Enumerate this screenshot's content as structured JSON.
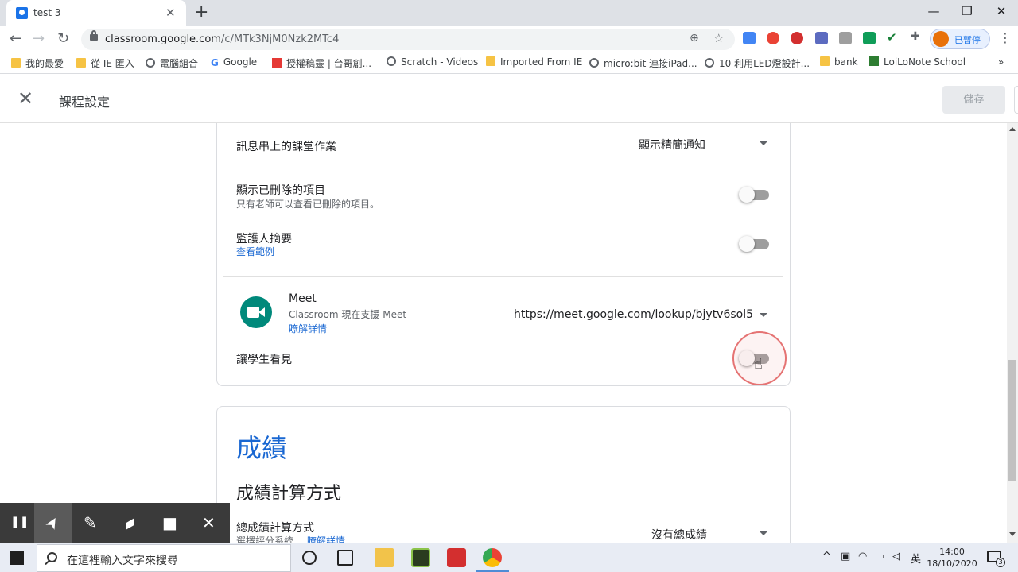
{
  "browser": {
    "tab_title": "test 3",
    "tab_close": "✕",
    "new_tab": "+",
    "minimize": "—",
    "maximize": "❐",
    "close_window": "✕",
    "url_host": "classroom.google.com",
    "url_path": "/c/MTk3NjM0Nzk2MTc4",
    "profile_label": "已暫停",
    "bookmarks": [
      "我的最愛",
      "從 IE 匯入",
      "電腦組合",
      "Google",
      "授權稿靈 | 台哥創...",
      "Scratch - Videos",
      "Imported From IE",
      "micro:bit 連接iPad...",
      "10 利用LED燈設計...",
      "bank",
      "LoiLoNote School"
    ],
    "bookmarks_more": "»"
  },
  "header": {
    "close": "✕",
    "title": "課程設定",
    "save": "儲存"
  },
  "general": {
    "stream_classwork_label": "訊息串上的課堂作業",
    "stream_classwork_value": "顯示精簡通知",
    "show_deleted_label": "顯示已刪除的項目",
    "show_deleted_desc": "只有老師可以查看已刪除的項目。",
    "guardian_label": "監護人摘要",
    "guardian_link": "查看範例"
  },
  "meet": {
    "title": "Meet",
    "desc": "Classroom 現在支援 Meet",
    "learn_more": "瞭解詳情",
    "link_value": "https://meet.google.com/lookup/bjytv6sol5",
    "visible_label": "讓學生看見"
  },
  "grading": {
    "section_title": "成績",
    "calc_title": "成績計算方式",
    "overall_label": "總成績計算方式",
    "overall_value": "沒有總成績",
    "overall_desc": "選擇評分系統",
    "overall_link": "瞭解詳情"
  },
  "recorder": {
    "pause": "❚❚",
    "pointer": "➤",
    "pen": "✎",
    "highlighter": "▰",
    "camera": "■",
    "close": "✕"
  },
  "taskbar": {
    "search_placeholder": "在這裡輸入文字來搜尋",
    "tray_up": "^",
    "ime": "英",
    "time": "14:00",
    "date": "18/10/2020",
    "notifications": "3"
  },
  "colors": {
    "accent": "#1967d2",
    "meet_green": "#00897b",
    "click_ring": "#e57373"
  }
}
